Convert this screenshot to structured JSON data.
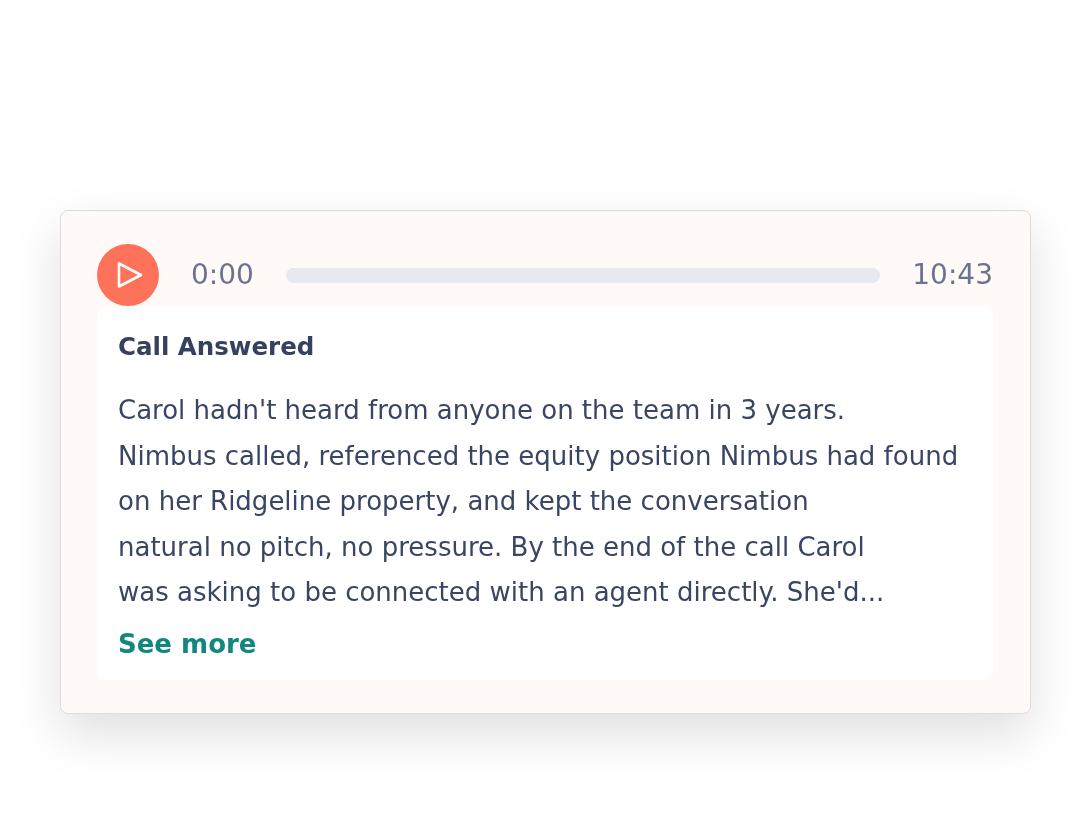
{
  "player": {
    "playing": false,
    "elapsed": "0:00",
    "level": 0,
    "duration": "10:43"
  },
  "summary": {
    "title": "Call Answered",
    "text": "Carol hadn't heard from anyone on the team in 3 years.\nNimbus called, referenced the equity position Nimbus had found\non her Ridgeline property, and kept the conversation\nnatural no pitch, no pressure. By the end of the call Carol\nwas asking to be connected with an agent directly. She'd...",
    "link": "See more"
  }
}
